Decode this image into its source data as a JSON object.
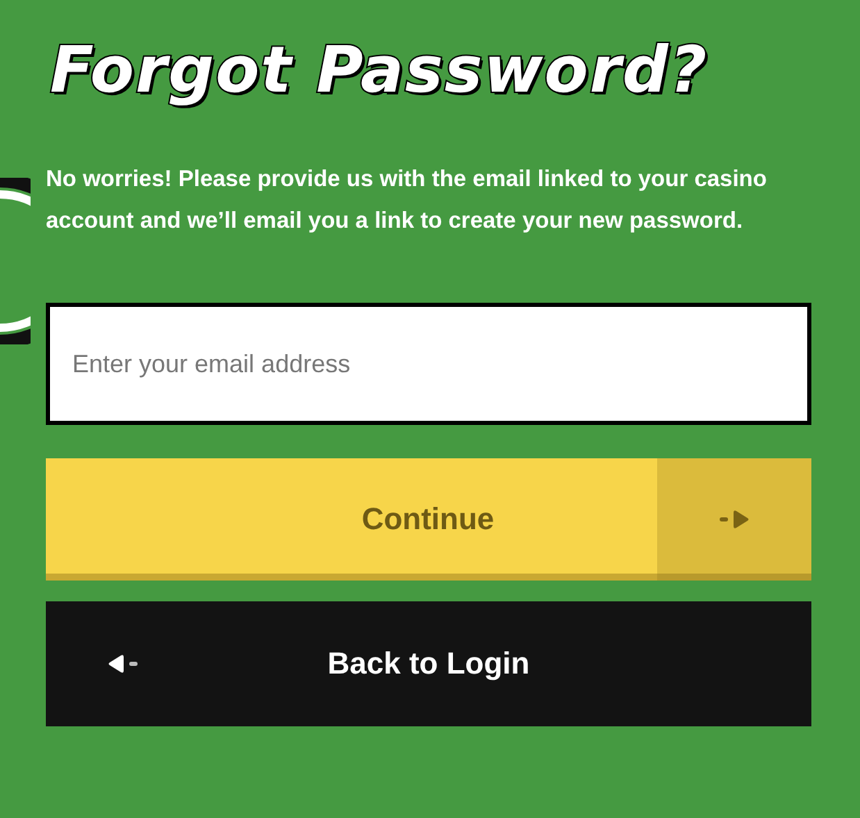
{
  "title": "Forgot Password?",
  "description": "No worries! Please provide us with the email linked to your casino account and we’ll email you a link to create your new password.",
  "email_field": {
    "placeholder": "Enter your email address"
  },
  "buttons": [
    {
      "kind": "primary",
      "label": "Continue"
    },
    {
      "kind": "back",
      "label": "Back to Login"
    }
  ]
}
